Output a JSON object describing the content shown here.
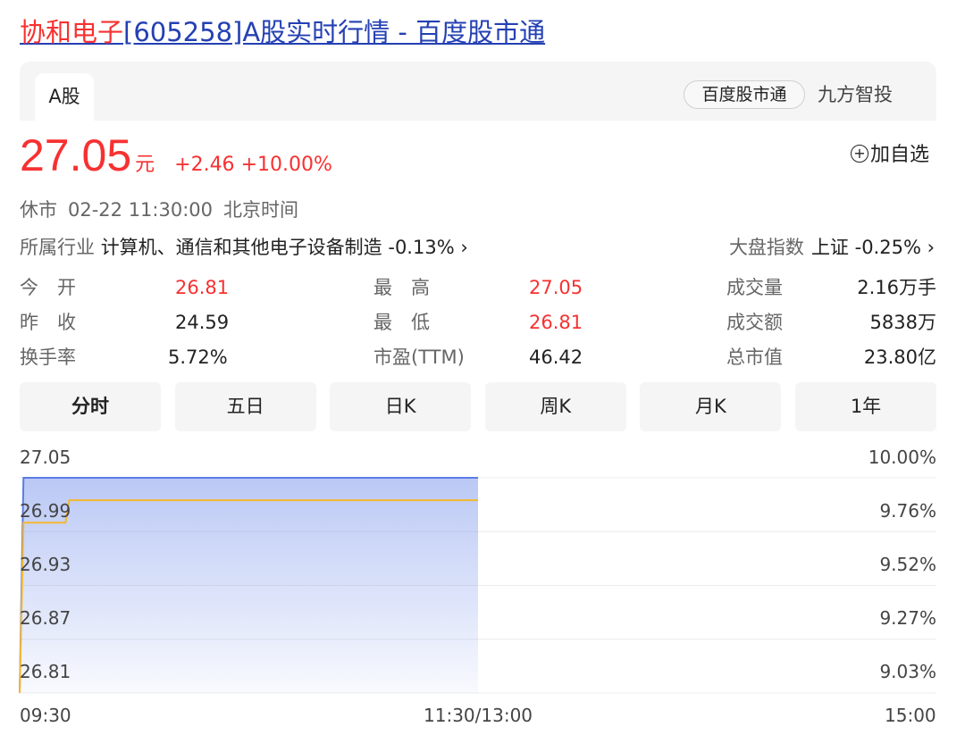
{
  "page_title": {
    "name": "协和电子",
    "rest": "[605258]A股实时行情 - 百度股市通"
  },
  "tabs": {
    "market": "A股"
  },
  "sources": {
    "primary": "百度股市通",
    "secondary": "九方智投"
  },
  "quote": {
    "price": "27.05",
    "unit": "元",
    "change": "+2.46",
    "change_pct": "+10.00%",
    "add_watch": "加自选",
    "add_watch_icon": "plus-circle-icon"
  },
  "status": {
    "state": "休市",
    "time": "02-22 11:30:00",
    "tz": "北京时间"
  },
  "industry": {
    "label": "所属行业",
    "value": "计算机、通信和其他电子设备制造 -0.13%",
    "arrow": "›"
  },
  "market_index": {
    "label": "大盘指数",
    "value": "上证 -0.25%",
    "arrow": "›"
  },
  "stats": {
    "open": {
      "label": "今　开",
      "value": "26.81"
    },
    "prev_close": {
      "label": "昨　收",
      "value": "24.59"
    },
    "turnover_rate": {
      "label": "换手率",
      "value": "5.72%"
    },
    "high": {
      "label": "最　高",
      "value": "27.05"
    },
    "low": {
      "label": "最　低",
      "value": "26.81"
    },
    "pe_ttm": {
      "label": "市盈(TTM)",
      "value": "46.42"
    },
    "volume": {
      "label": "成交量",
      "value": "2.16万手"
    },
    "amount": {
      "label": "成交额",
      "value": "5838万"
    },
    "market_cap": {
      "label": "总市值",
      "value": "23.80亿"
    }
  },
  "period_tabs": [
    "分时",
    "五日",
    "日K",
    "周K",
    "月K",
    "1年"
  ],
  "active_period": "分时",
  "colors": {
    "up": "#f73131",
    "line": "#f5b82e",
    "area_top": "#5b7ce6",
    "link": "#2440b3"
  },
  "chart_data": {
    "type": "area",
    "title": "",
    "y_left_ticks": [
      "27.05",
      "26.99",
      "26.93",
      "26.87",
      "26.81"
    ],
    "y_right_ticks": [
      "10.00%",
      "9.76%",
      "9.52%",
      "9.27%",
      "9.03%"
    ],
    "x_ticks": [
      "09:30",
      "11:30/13:00",
      "15:00"
    ],
    "ylim": [
      26.81,
      27.05
    ],
    "x_range_minutes": [
      0,
      240
    ],
    "grid": true,
    "series": [
      {
        "kind": "price_area",
        "points": [
          [
            0,
            26.81
          ],
          [
            1,
            27.05
          ],
          [
            120,
            27.05
          ]
        ]
      },
      {
        "kind": "average_line",
        "points": [
          [
            0,
            26.81
          ],
          [
            1,
            27.0
          ],
          [
            12,
            27.0
          ],
          [
            13,
            27.025
          ],
          [
            120,
            27.025
          ]
        ]
      }
    ]
  }
}
